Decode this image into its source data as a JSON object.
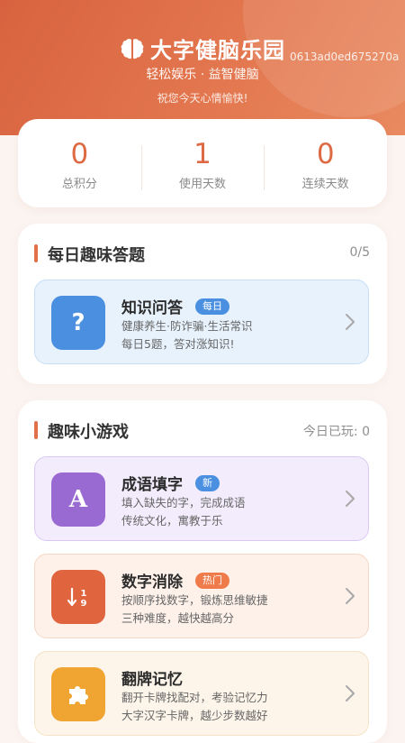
{
  "header": {
    "title": "大字健脑乐园",
    "subtitle": "轻松娱乐 · 益智健脑",
    "greeting": "祝您今天心情愉快!",
    "overlay_id": "0613ad0ed675270a"
  },
  "stats": [
    {
      "value": "0",
      "label": "总积分"
    },
    {
      "value": "1",
      "label": "使用天数"
    },
    {
      "value": "0",
      "label": "连续天数"
    }
  ],
  "quiz_section": {
    "title": "每日趣味答题",
    "progress": "0/5",
    "item": {
      "title": "知识问答",
      "badge": "每日",
      "line1": "健康养生·防诈骗·生活常识",
      "line2": "每日5题，答对涨知识!"
    }
  },
  "games_section": {
    "title": "趣味小游戏",
    "played_today": "今日已玩: 0",
    "items": [
      {
        "title": "成语填字",
        "badge": "新",
        "line1": "填入缺失的字，完成成语",
        "line2": "传统文化，寓教于乐",
        "icon": "letter-a-icon",
        "color": "#9a6ad3",
        "bg": "#f3ecfc",
        "border": "#d9c8f2",
        "badge_color": "#4a8fe0"
      },
      {
        "title": "数字消除",
        "badge": "热门",
        "line1": "按顺序找数字，锻炼思维敏捷",
        "line2": "三种难度，越快越高分",
        "icon": "sort-numbers-icon",
        "color": "#e0653f",
        "bg": "#fdf1ea",
        "border": "#f5d7c8",
        "badge_color": "#ef7a4a"
      },
      {
        "title": "翻牌记忆",
        "line1": "翻开卡牌找配对，考验记忆力",
        "line2": "大字汉字卡牌，越少步数越好",
        "icon": "puzzle-icon",
        "color": "#f0a532",
        "bg": "#fdf5ea",
        "border": "#f6e2c6"
      }
    ]
  },
  "colors": {
    "accent": "#e07048",
    "quiz_icon": "#4a8fe0"
  }
}
